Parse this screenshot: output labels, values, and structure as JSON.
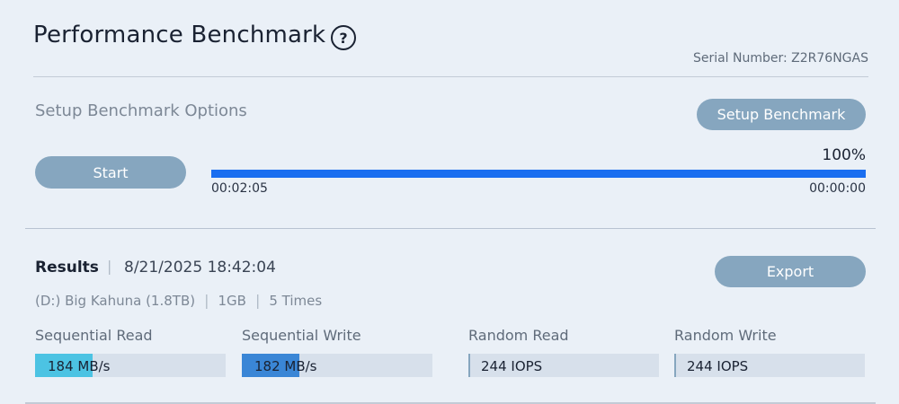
{
  "header": {
    "title": "Performance Benchmark",
    "help_icon": "question-circle-icon",
    "help_glyph": "?",
    "serial": "Serial Number: Z2R76NGAS"
  },
  "setup": {
    "title": "Setup Benchmark Options",
    "setup_button": "Setup Benchmark",
    "start_button": "Start",
    "progress_percent": 100,
    "progress_text": "100%",
    "elapsed": "00:02:05",
    "remaining": "00:00:00"
  },
  "results": {
    "label": "Results",
    "separator": "|",
    "timestamp": "8/21/2025 18:42:04",
    "export_button": "Export",
    "drive": "(D:) Big Kahuna (1.8TB)",
    "size": "1GB",
    "runs": "5 Times",
    "metrics": [
      {
        "label": "Sequential Read",
        "value": "184 MB/s",
        "fill_fraction": 0.3,
        "color": "#4cc3e3"
      },
      {
        "label": "Sequential Write",
        "value": "182 MB/s",
        "fill_fraction": 0.3,
        "color": "#3a86d6"
      },
      {
        "label": "Random Read",
        "value": "244 IOPS",
        "fill_fraction": 0,
        "color": "#86a6bf"
      },
      {
        "label": "Random Write",
        "value": "244 IOPS",
        "fill_fraction": 0,
        "color": "#86a6bf"
      }
    ]
  },
  "colors": {
    "background": "#eaf0f7",
    "button": "#86a6bf",
    "progress": "#1a6ef0"
  }
}
